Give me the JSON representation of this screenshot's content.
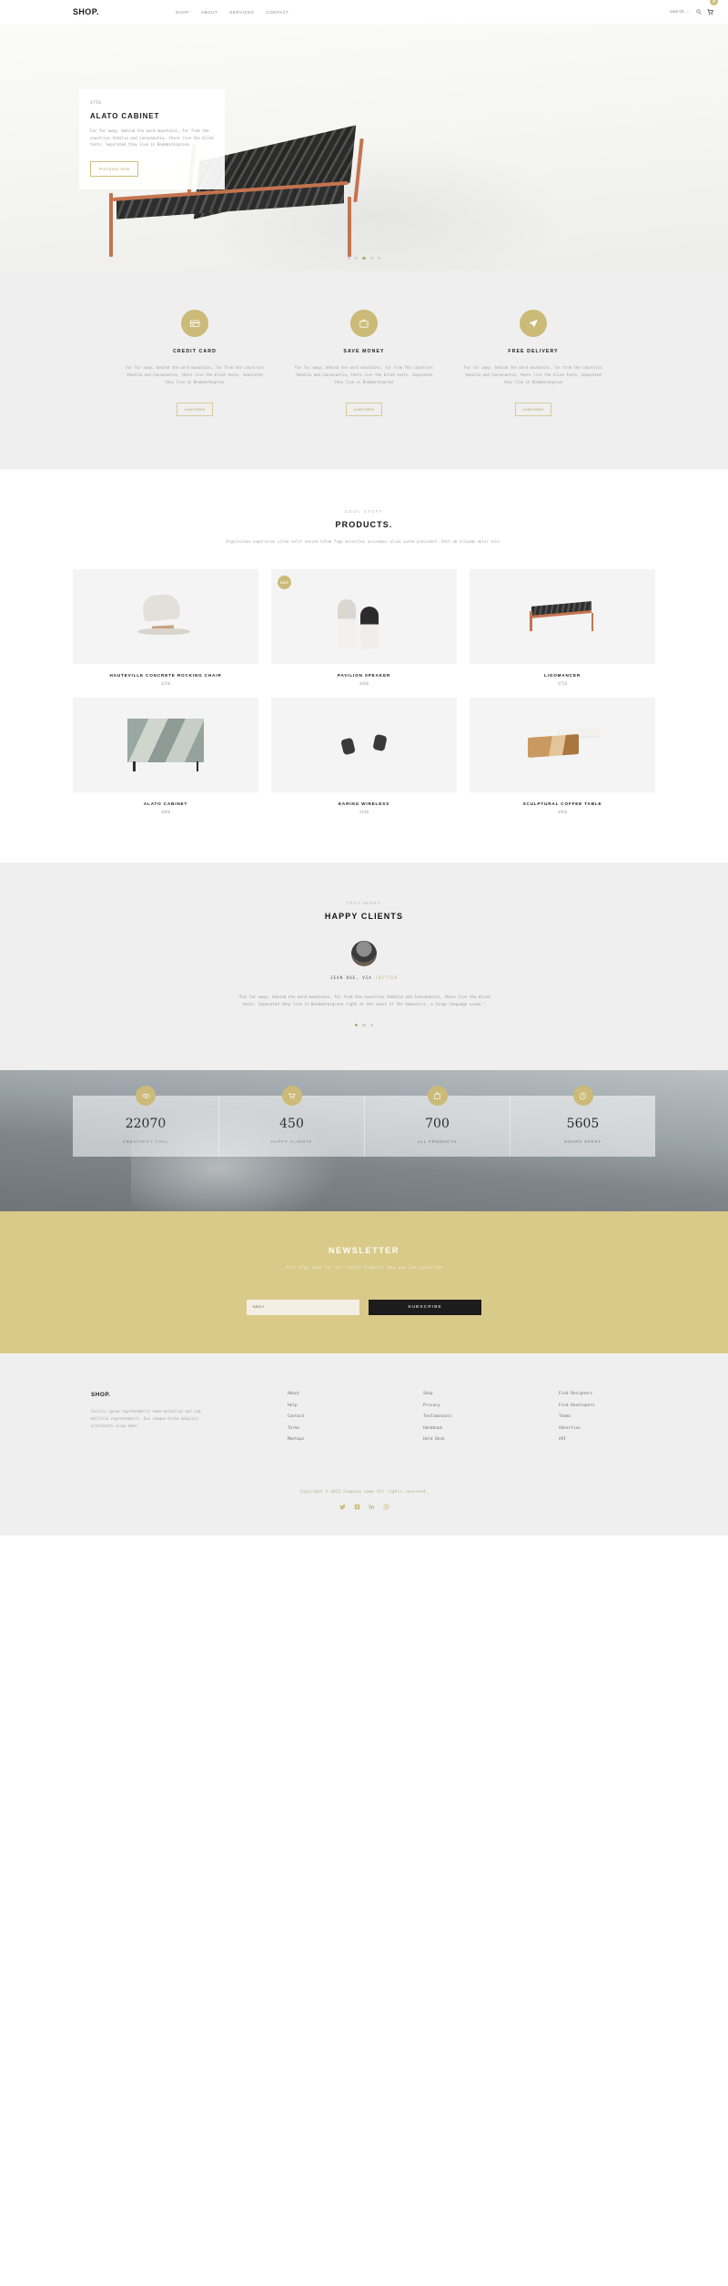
{
  "header": {
    "logo": "SHOP.",
    "nav": [
      {
        "label": "SHOP"
      },
      {
        "label": "ABOUT"
      },
      {
        "label": "SERVICES"
      },
      {
        "label": "CONTACT"
      }
    ],
    "search_placeholder": "Search...",
    "cart_count": "0"
  },
  "hero": {
    "price": "$750",
    "title": "ALATO CABINET",
    "text": "Far far away, behind the word mountains, far from the countries Vokalia and Consonantia, there live the blind texts. Separated they live in Bookmarksgrove.",
    "button": "Purchase Now",
    "slides": [
      "1",
      "2",
      "3",
      "4",
      "5"
    ],
    "active_slide": 2
  },
  "features": [
    {
      "icon": "credit-card-icon",
      "title": "CREDIT CARD",
      "text": "Far far away, behind the word mountains, far from the countries Vokalia and Consonantia, there live the blind texts. Separated they live in Bookmarksgrove",
      "button": "Learn More"
    },
    {
      "icon": "wallet-icon",
      "title": "SAVE MONEY",
      "text": "Far far away, behind the word mountains, far from the countries Vokalia and Consonantia, there live the blind texts. Separated they live in Bookmarksgrove",
      "button": "Learn More"
    },
    {
      "icon": "paper-plane-icon",
      "title": "FREE DELIVERY",
      "text": "Far far away, behind the word mountains, far from the countries Vokalia and Consonantia, there live the blind texts. Separated they live in Bookmarksgrove",
      "button": "Learn More"
    }
  ],
  "products_section": {
    "eyebrow": "COOL STUFF",
    "title": "PRODUCTS.",
    "subtitle": "Dignissimos asperiores vitae velit veniam totam fuga molestias accusamus alias autem provident. Odit ab aliquam dolor eius.",
    "items": [
      {
        "name": "HAUTEVILLE CONCRETE ROCKING CHAIR",
        "price": "$350",
        "badge": ""
      },
      {
        "name": "PAVILION SPEAKER",
        "price": "$600",
        "badge": "Sale"
      },
      {
        "name": "LIGOMANCER",
        "price": "$750",
        "badge": ""
      },
      {
        "name": "ALATO CABINET",
        "price": "$800",
        "badge": ""
      },
      {
        "name": "EARING WIRELESS",
        "price": "$100",
        "badge": ""
      },
      {
        "name": "SCULPTURAL COFFEE TABLE",
        "price": "$960",
        "badge": ""
      }
    ]
  },
  "testimony": {
    "eyebrow": "TESTIMONY",
    "title": "HAPPY CLIENTS",
    "author_name": "JEAN DOE, VIA ",
    "author_source": "TWITTER",
    "quote": "\"Far far away, behind the word mountains, far from the countries Vokalia and Consonantia, there live the blind texts. Separated they live in Bookmarksgrove right at the coast of the Semantics, a large language ocean.\"",
    "dots": [
      "1",
      "2",
      "3"
    ],
    "active_dot": 0
  },
  "stats": [
    {
      "icon": "eye-icon",
      "number": "22070",
      "label": "CREATIVITY FUEL"
    },
    {
      "icon": "cart-icon",
      "number": "450",
      "label": "HAPPY CLIENTS"
    },
    {
      "icon": "bag-icon",
      "number": "700",
      "label": "ALL PRODUCTS"
    },
    {
      "icon": "clock-icon",
      "number": "5605",
      "label": "HOURS SPENT"
    }
  ],
  "newsletter": {
    "title": "NEWSLETTER",
    "subtitle": "Just stay tune for our latest Product, Now you can subscribe",
    "email_placeholder": "Email",
    "button": "SUBSCRIBE"
  },
  "footer": {
    "logo": "SHOP.",
    "description": "Facilis ipsam reprehenderit nemo molestias aut cum mollitia reprehenderit. Eos cumque dicta adipisci architecto culpa amet.",
    "columns": [
      {
        "links": [
          "About",
          "Help",
          "Contact",
          "Terms",
          "Meetups"
        ]
      },
      {
        "links": [
          "Shop",
          "Privacy",
          "Testimonials",
          "Handbook",
          "Held Desk"
        ]
      },
      {
        "links": [
          "Find Designers",
          "Find Developers",
          "Teams",
          "Advertise",
          "API"
        ]
      }
    ],
    "copyright": "Copyright © 2022.Company name All rights reserved.",
    "socials": [
      "twitter-icon",
      "facebook-icon",
      "linkedin-icon",
      "dribbble-icon"
    ]
  },
  "colors": {
    "gold": "#cbba78",
    "newsletter_bg": "#d9ca8a",
    "dark": "#1c1c1c"
  }
}
